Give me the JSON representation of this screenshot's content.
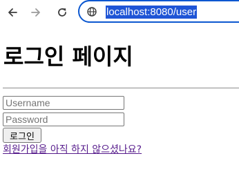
{
  "browser": {
    "url": "localhost:8080/user"
  },
  "page": {
    "title": "로그인 페이지",
    "username_placeholder": "Username",
    "password_placeholder": "Password",
    "login_button": "로그인",
    "signup_link": "회원가입을 아직 하지 않으셨나요?"
  },
  "colors": {
    "omnibox_border": "#0b57d0",
    "url_selection": "#1f55d6",
    "visited_link": "#551a8b"
  }
}
